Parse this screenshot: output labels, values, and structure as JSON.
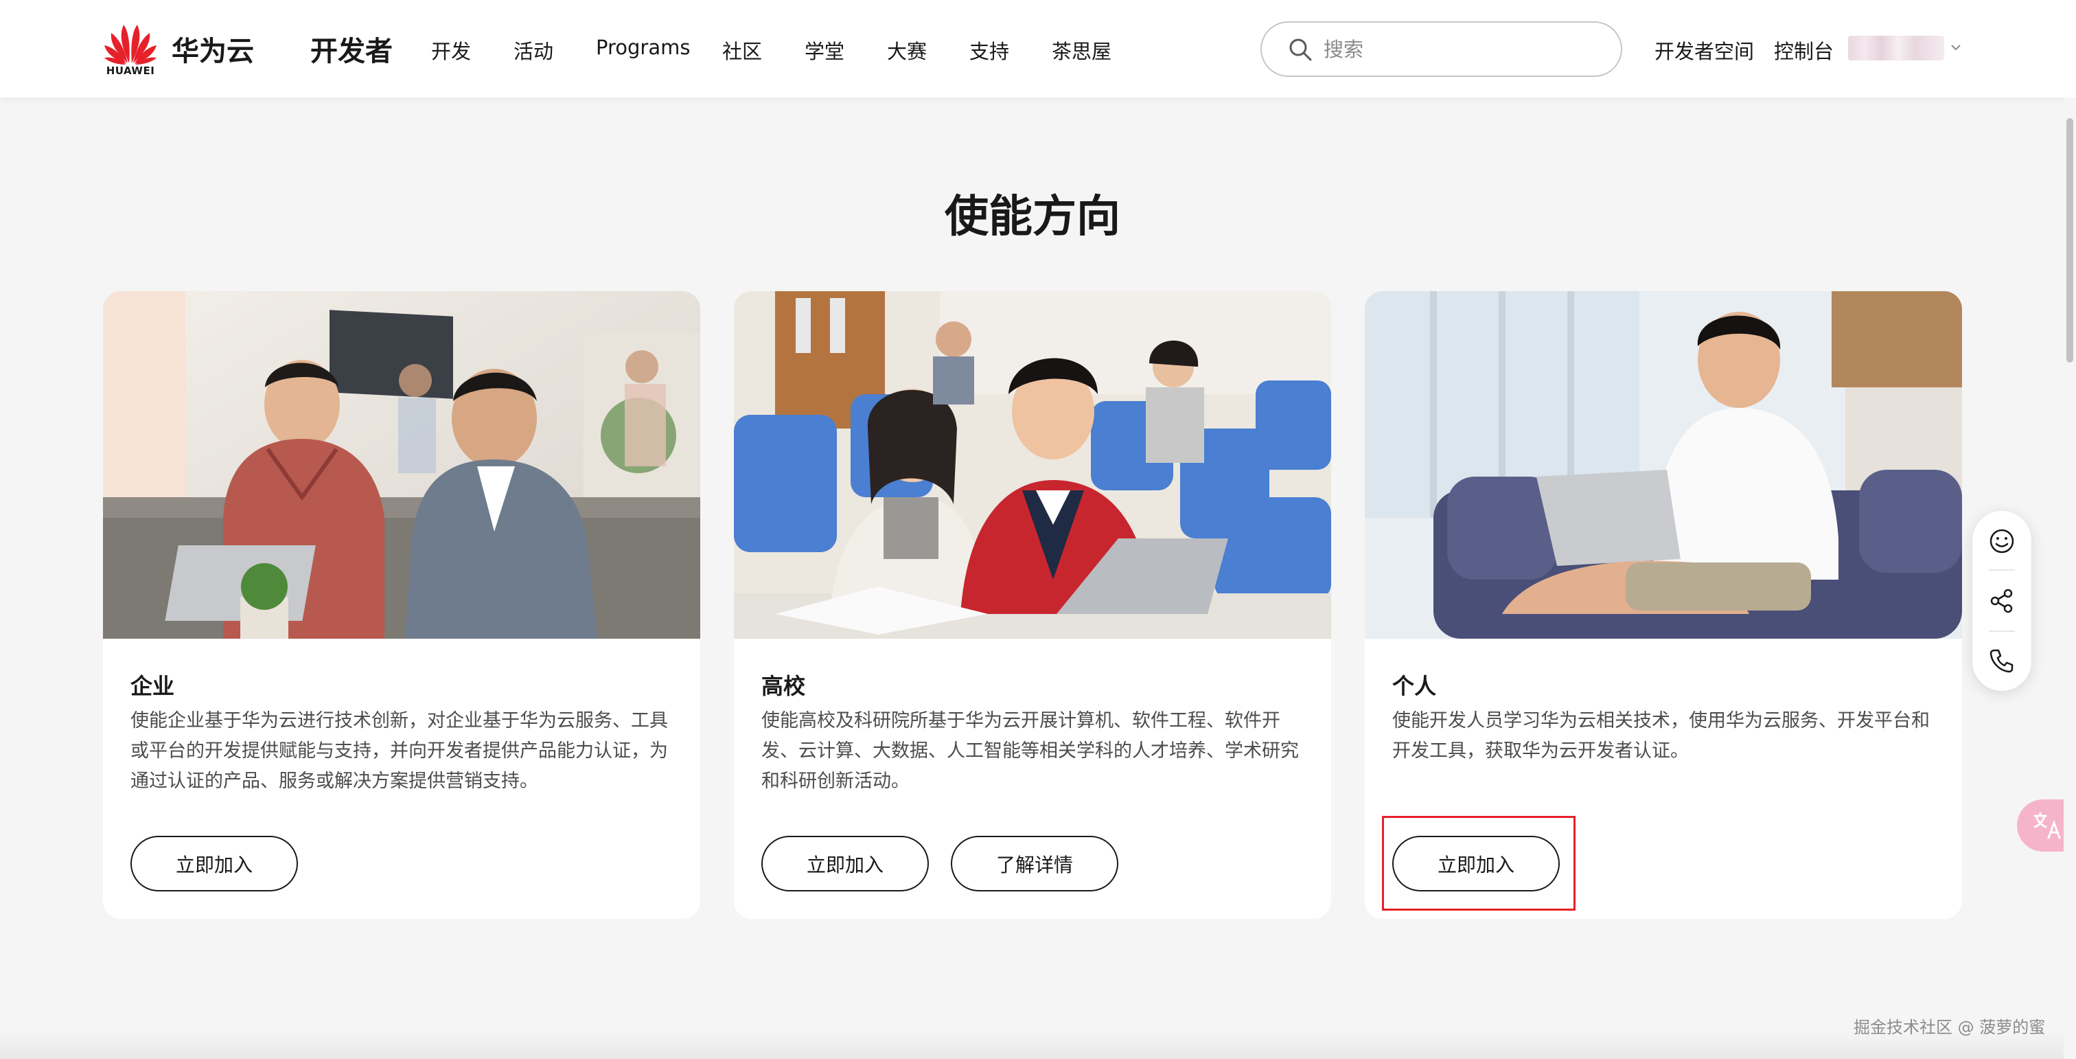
{
  "header": {
    "logo_text": "HUAWEI",
    "brand": "华为云",
    "section": "开发者",
    "nav": [
      {
        "label": "开发",
        "name": "nav-dev"
      },
      {
        "label": "活动",
        "name": "nav-events"
      },
      {
        "label": "Programs",
        "name": "nav-programs"
      },
      {
        "label": "社区",
        "name": "nav-community"
      },
      {
        "label": "学堂",
        "name": "nav-academy"
      },
      {
        "label": "大赛",
        "name": "nav-contests"
      },
      {
        "label": "支持",
        "name": "nav-support"
      },
      {
        "label": "茶思屋",
        "name": "nav-teahouse"
      }
    ],
    "search": {
      "placeholder": "搜索",
      "value": ""
    },
    "dev_space": "开发者空间",
    "console": "控制台",
    "brand_color": "#e6212a"
  },
  "main": {
    "title": "使能方向",
    "cards": [
      {
        "title": "企业",
        "image": "enterprise-photo",
        "desc": "使能企业基于华为云进行技术创新，对企业基于华为云服务、工具或平台的开发提供赋能与支持，并向开发者提供产品能力认证，为通过认证的产品、服务或解决方案提供营销支持。",
        "buttons": [
          "立即加入"
        ]
      },
      {
        "title": "高校",
        "image": "university-photo",
        "desc": "使能高校及科研院所基于华为云开展计算机、软件工程、软件开发、云计算、大数据、人工智能等相关学科的人才培养、学术研究和科研创新活动。",
        "buttons": [
          "立即加入",
          "了解详情"
        ]
      },
      {
        "title": "个人",
        "image": "individual-photo",
        "desc": "使能开发人员学习华为云相关技术，使用华为云服务、开发平台和开发工具，获取华为云开发者认证。",
        "buttons": [
          "立即加入"
        ]
      }
    ]
  },
  "floating_tools": [
    "smile-icon",
    "share-icon",
    "phone-icon",
    "translate-icon"
  ],
  "watermark": "掘金技术社区 @ 菠萝的蜜"
}
